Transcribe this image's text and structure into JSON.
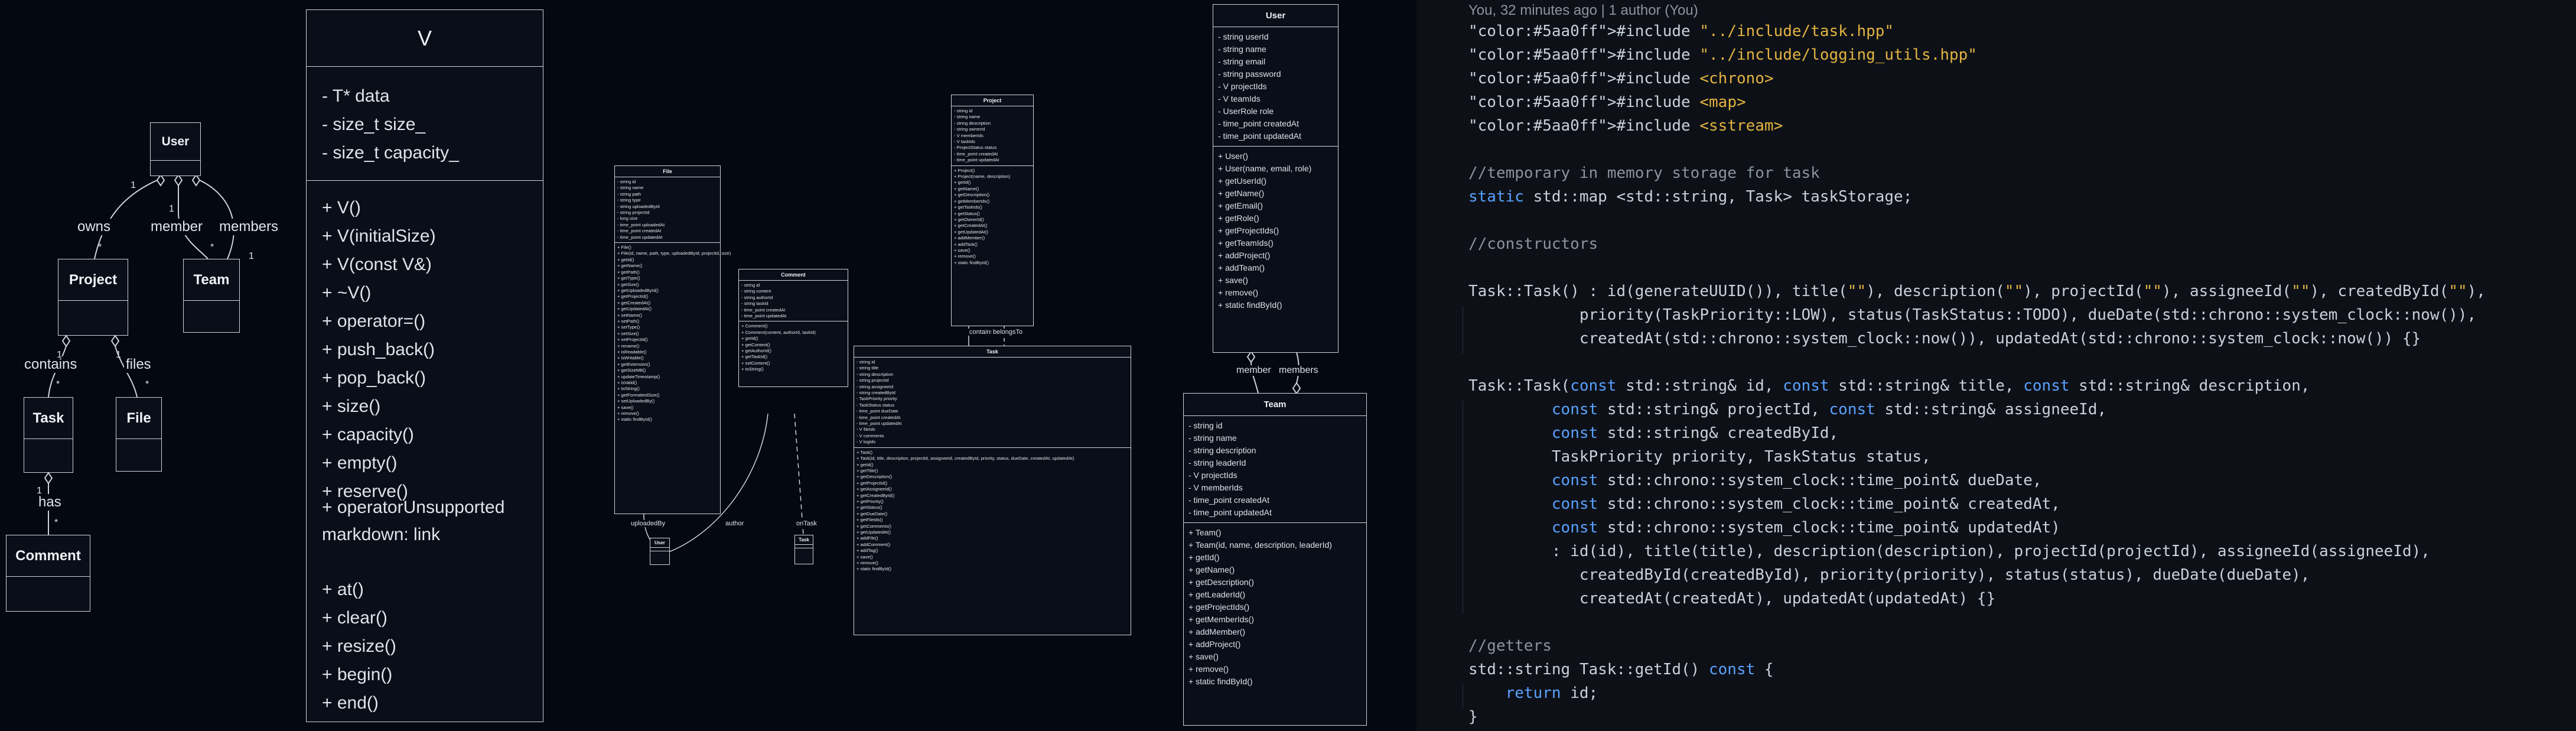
{
  "diagram1": {
    "classes": {
      "user": "User",
      "project": "Project",
      "team": "Team",
      "task": "Task",
      "file": "File",
      "comment": "Comment"
    },
    "relations": {
      "owns": "owns",
      "member": "member",
      "members": "members",
      "contains": "contains",
      "files": "files",
      "has": "has"
    },
    "multiplicity": {
      "one": "1",
      "many": "*"
    }
  },
  "vector_class": {
    "name": "V",
    "attributes": [
      "- T* data",
      "- size_t size_",
      "- size_t capacity_"
    ],
    "methods_a": [
      "+ V()",
      "+ V(initialSize)",
      "+ V(const V&)",
      "+ ~V()",
      "+ operator=()",
      "+ push_back()",
      "+ pop_back()",
      "+ size()",
      "+ capacity()",
      "+ empty()",
      "+ reserve()"
    ],
    "overlay_text": "+ operatorUnsupported markdown: link",
    "methods_b": [
      "+ at()",
      "+ clear()",
      "+ resize()",
      "+ begin()",
      "+ end()"
    ]
  },
  "diagram2": {
    "file": {
      "name": "File",
      "attributes": [
        "- string id",
        "- string name",
        "- string path",
        "- string type",
        "- string uploadedById",
        "- string projectId",
        "- long size",
        "- time_point uploadedAt",
        "- time_point createdAt",
        "- time_point updatedAt"
      ],
      "methods": [
        "+ File()",
        "+ File(id, name, path, type, uploadedById, projectId, size)",
        "+ getId()",
        "+ getName()",
        "+ getPath()",
        "+ getType()",
        "+ getSize()",
        "+ getUploadedById()",
        "+ getProjectId()",
        "+ getCreatedAt()",
        "+ getUpdatedAt()",
        "+ setName()",
        "+ setPath()",
        "+ setType()",
        "+ setSize()",
        "+ setProjectId()",
        "+ rename()",
        "+ isReadable()",
        "+ isWritable()",
        "+ getExtension()",
        "+ getSizeMB()",
        "+ updateTimestamp()",
        "+ isValid()",
        "+ toString()",
        "+ getFormattedSize()",
        "+ setUploadedBy()",
        "+ save()",
        "+ remove()",
        "+ static findById()"
      ]
    },
    "comment": {
      "name": "Comment",
      "attributes": [
        "- string id",
        "- string content",
        "- string authorId",
        "- string taskId",
        "- time_point createdAt",
        "- time_point updatedAt"
      ],
      "methods": [
        "+ Comment()",
        "+ Comment(content, authorId, taskId)",
        "+ getId()",
        "+ getContent()",
        "+ getAuthorId()",
        "+ getTaskId()",
        "+ setContent()",
        "+ toString()"
      ]
    },
    "project": {
      "name": "Project",
      "attributes": [
        "- string id",
        "- string name",
        "- string description",
        "- string ownerId",
        "- V memberIds",
        "- V taskIds",
        "- ProjectStatus status",
        "- time_point createdAt",
        "- time_point updatedAt"
      ],
      "methods": [
        "+ Project()",
        "+ Project(name, description)",
        "+ getId()",
        "+ getName()",
        "+ getDescription()",
        "+ getMemberIds()",
        "+ getTaskIds()",
        "+ getStatus()",
        "+ getOwnerId()",
        "+ getCreatedAt()",
        "+ getUpdatedAt()",
        "+ addMember()",
        "+ addTask()",
        "+ save()",
        "+ remove()",
        "+ static findById()"
      ]
    },
    "task": {
      "name": "Task",
      "attributes": [
        "- string id",
        "- string title",
        "- string description",
        "- string projectId",
        "- string assigneeId",
        "- string createdById",
        "- TaskPriority priority",
        "- TaskStatus status",
        "- time_point dueDate",
        "- time_point createdAt",
        "- time_point updatedAt",
        "- V fileIds",
        "- V comments",
        "- V logIds"
      ],
      "methods": [
        "+ Task()",
        "+ Task(id, title, description, projectId, assigneeId, createdById, priority, status, dueDate, createdAt, updatedAt)",
        "+ getId()",
        "+ getTitle()",
        "+ getDescription()",
        "+ getProjectId()",
        "+ getAssigneeId()",
        "+ getCreatedById()",
        "+ getPriority()",
        "+ getStatus()",
        "+ getDueDate()",
        "+ getFileIds()",
        "+ getComments()",
        "+ getUpdatedAt()",
        "+ addFile()",
        "+ addComment()",
        "+ addTag()",
        "+ save()",
        "+ remove()",
        "+ static findById()"
      ]
    },
    "user_stub": "User",
    "task_stub": "Task",
    "labels": {
      "uploadedBy": "uploadedBy",
      "author": "author",
      "onTask": "onTask",
      "contains": "contains",
      "belongsTo": "belongsTo"
    }
  },
  "diagram3": {
    "user": {
      "name": "User",
      "attributes": [
        "- string userId",
        "- string name",
        "- string email",
        "- string password",
        "- V projectIds",
        "- V teamIds",
        "- UserRole role",
        "- time_point createdAt",
        "- time_point updatedAt"
      ],
      "methods": [
        "+ User()",
        "+ User(name, email, role)",
        "+ getUserId()",
        "+ getName()",
        "+ getEmail()",
        "+ getRole()",
        "+ getProjectIds()",
        "+ getTeamIds()",
        "+ addProject()",
        "+ addTeam()",
        "+ save()",
        "+ remove()",
        "+ static findById()"
      ]
    },
    "team": {
      "name": "Team",
      "attributes": [
        "- string id",
        "- string name",
        "- string description",
        "- string leaderId",
        "- V projectIds",
        "- V memberIds",
        "- time_point createdAt",
        "- time_point updatedAt"
      ],
      "methods": [
        "+ Team()",
        "+ Team(id, name, description, leaderId)",
        "+ getId()",
        "+ getName()",
        "+ getDescription()",
        "+ getLeaderId()",
        "+ getProjectIds()",
        "+ getMemberIds()",
        "+ addMember()",
        "+ addProject()",
        "+ save()",
        "+ remove()",
        "+ static findById()"
      ]
    },
    "labels": {
      "member": "member",
      "members": "members"
    }
  },
  "editor": {
    "blame": "You, 32 minutes ago | 1 author (You)",
    "colors": {
      "background": "#0d1117",
      "keyword": "#5aa0ff",
      "string": "#e3b341",
      "comment": "#8b949e",
      "param": "#f0a050"
    },
    "lines": [
      "#include \"../include/task.hpp\"",
      "#include \"../include/logging_utils.hpp\"",
      "#include <chrono>",
      "#include <map>",
      "#include <sstream>",
      "",
      "//temporary in memory storage for task",
      "static std::map <std::string, Task> taskStorage;",
      "",
      "//constructors",
      "",
      "Task::Task() : id(generateUUID()), title(\"\"), description(\"\"), projectId(\"\"), assigneeId(\"\"), createdById(\"\"),",
      "            priority(TaskPriority::LOW), status(TaskStatus::TODO), dueDate(std::chrono::system_clock::now()),",
      "            createdAt(std::chrono::system_clock::now()), updatedAt(std::chrono::system_clock::now()) {}",
      "",
      "Task::Task(const std::string& id, const std::string& title, const std::string& description,",
      "         const std::string& projectId, const std::string& assigneeId,",
      "         const std::string& createdById,",
      "         TaskPriority priority, TaskStatus status,",
      "         const std::chrono::system_clock::time_point& dueDate,",
      "         const std::chrono::system_clock::time_point& createdAt,",
      "         const std::chrono::system_clock::time_point& updatedAt)",
      "         : id(id), title(title), description(description), projectId(projectId), assigneeId(assigneeId),",
      "            createdById(createdById), priority(priority), status(status), dueDate(dueDate),",
      "            createdAt(createdAt), updatedAt(updatedAt) {}",
      "",
      "//getters",
      "std::string Task::getId() const {",
      "    return id;",
      "}"
    ]
  }
}
